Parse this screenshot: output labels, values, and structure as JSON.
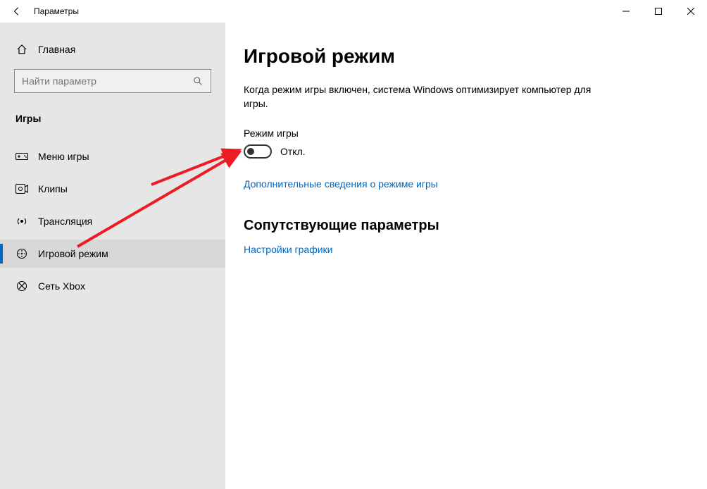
{
  "window": {
    "title": "Параметры"
  },
  "sidebar": {
    "home": "Главная",
    "search_placeholder": "Найти параметр",
    "category": "Игры",
    "items": [
      {
        "label": "Меню игры"
      },
      {
        "label": "Клипы"
      },
      {
        "label": "Трансляция"
      },
      {
        "label": "Игровой режим"
      },
      {
        "label": "Сеть Xbox"
      }
    ]
  },
  "main": {
    "title": "Игровой режим",
    "description": "Когда режим игры включен, система Windows оптимизирует компьютер для игры.",
    "toggle_label": "Режим игры",
    "toggle_state": "Откл.",
    "learn_more": "Дополнительные сведения о режиме игры",
    "related_title": "Сопутствующие параметры",
    "related_link": "Настройки графики"
  }
}
